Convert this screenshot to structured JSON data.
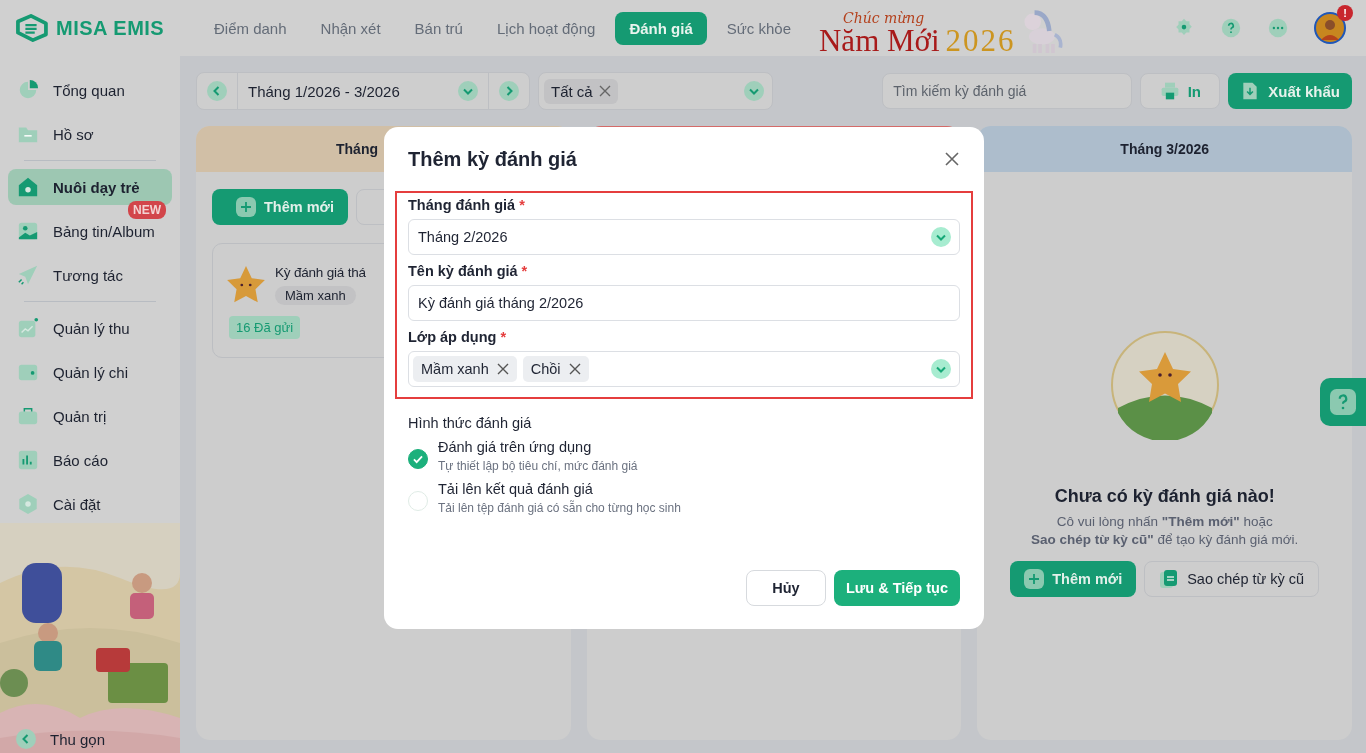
{
  "app": {
    "logo": "MISA EMIS"
  },
  "nav_tabs": [
    {
      "label": "Điểm danh",
      "selected": false
    },
    {
      "label": "Nhận xét",
      "selected": false
    },
    {
      "label": "Bán trú",
      "selected": false
    },
    {
      "label": "Lịch hoạt động",
      "selected": false
    },
    {
      "label": "Đánh giá",
      "selected": true
    },
    {
      "label": "Sức khỏe",
      "selected": false
    }
  ],
  "banner": {
    "greeting": "Chúc mừng",
    "title": "Năm Mới",
    "year": "2026"
  },
  "user": {
    "badge": "!"
  },
  "sidebar": {
    "groups": [
      [
        {
          "label": "Tổng quan",
          "selected": false
        },
        {
          "label": "Hồ sơ",
          "selected": false
        }
      ],
      [
        {
          "label": "Nuôi dạy trẻ",
          "selected": true
        },
        {
          "label": "Bảng tin/Album",
          "selected": false,
          "badge": "NEW"
        },
        {
          "label": "Tương tác",
          "selected": false
        }
      ],
      [
        {
          "label": "Quản lý thu",
          "selected": false
        },
        {
          "label": "Quản lý chi",
          "selected": false
        },
        {
          "label": "Quản trị",
          "selected": false
        },
        {
          "label": "Báo cáo",
          "selected": false
        },
        {
          "label": "Cài đặt",
          "selected": false
        }
      ]
    ],
    "collapse": "Thu gọn"
  },
  "toolbar": {
    "period": "Tháng 1/2026 - 3/2026",
    "class_filter": [
      "Tất cả"
    ],
    "search": {
      "placeholder": "Tìm kiếm kỳ đánh giá"
    },
    "print": "In",
    "export": "Xuất khẩu"
  },
  "columns": [
    {
      "title": "Tháng",
      "color": "#d1bfa6",
      "add": "Thêm mới",
      "cards": [
        {
          "title": "Kỳ đánh giá thá",
          "tag": "Mầm xanh",
          "status": "16 Đã gửi"
        }
      ]
    },
    {
      "color": "#d46a68"
    },
    {
      "title": "Tháng 3/2026",
      "color": "#adbdcc",
      "empty": {
        "title": "Chưa có kỳ đánh giá nào!",
        "lines": [
          "Cô vui lòng nhấn **\"Thêm mới\"** hoặc",
          "**Sao chép từ kỳ cũ\"** để tạo kỳ đánh giá mới."
        ],
        "add": "Thêm mới",
        "copy": "Sao chép từ kỳ cũ"
      }
    }
  ],
  "dialog": {
    "title": "Thêm kỳ đánh giá",
    "fields": [
      {
        "kind": "select",
        "label": "Tháng đánh giá",
        "required_mark": "*",
        "value": "Tháng 2/2026"
      },
      {
        "kind": "text",
        "label": "Tên kỳ đánh giá",
        "required_mark": "*",
        "value": "Kỳ đánh giá tháng 2/2026"
      },
      {
        "kind": "multi",
        "label": "Lớp áp dụng",
        "required_mark": "*",
        "chips": [
          "Mầm xanh",
          "Chồi"
        ]
      }
    ],
    "method": {
      "label": "Hình thức đánh giá",
      "options": [
        {
          "title": "Đánh giá trên ứng dụng",
          "description": "Tự thiết lập bộ tiêu chí, mức đánh giá",
          "selected": true
        },
        {
          "title": "Tải lên kết quả đánh giá",
          "description": "Tải lên tệp đánh giá có sẵn cho từng học sinh",
          "selected": false
        }
      ]
    },
    "cancel": "Hủy",
    "submit": "Lưu & Tiếp tục"
  }
}
